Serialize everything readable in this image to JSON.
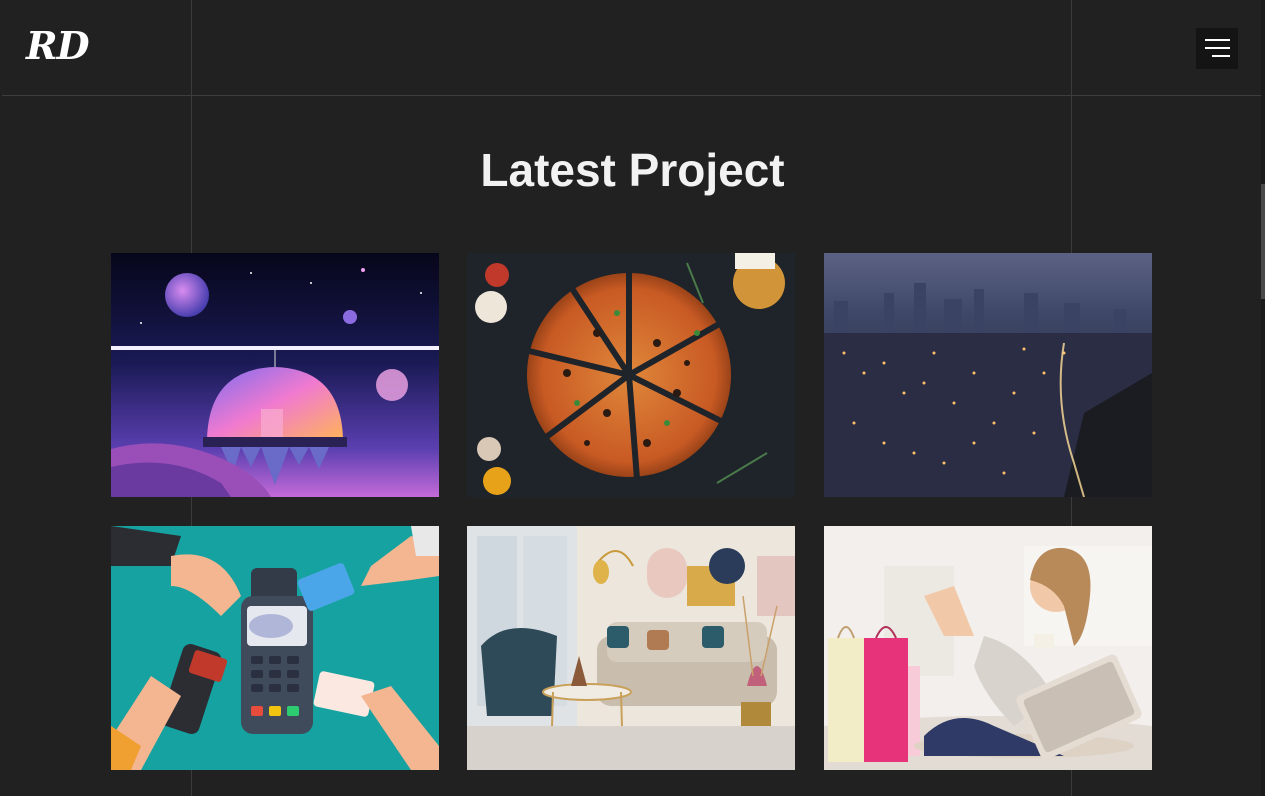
{
  "header": {
    "logo_text": "RD",
    "menu_icon": "hamburger-icon"
  },
  "section": {
    "title": "Latest Project"
  },
  "projects": [
    {
      "image": "space-dome-illustration"
    },
    {
      "image": "sliced-pizza-photo"
    },
    {
      "image": "city-night-skyline-photo"
    },
    {
      "image": "contactless-payment-illustration"
    },
    {
      "image": "living-room-interior-photo"
    },
    {
      "image": "woman-online-shopping-photo"
    }
  ],
  "colors": {
    "background": "#212121",
    "header_border": "#3d3d3d",
    "menu_button_bg": "#141414",
    "title": "#f2f2f2"
  }
}
